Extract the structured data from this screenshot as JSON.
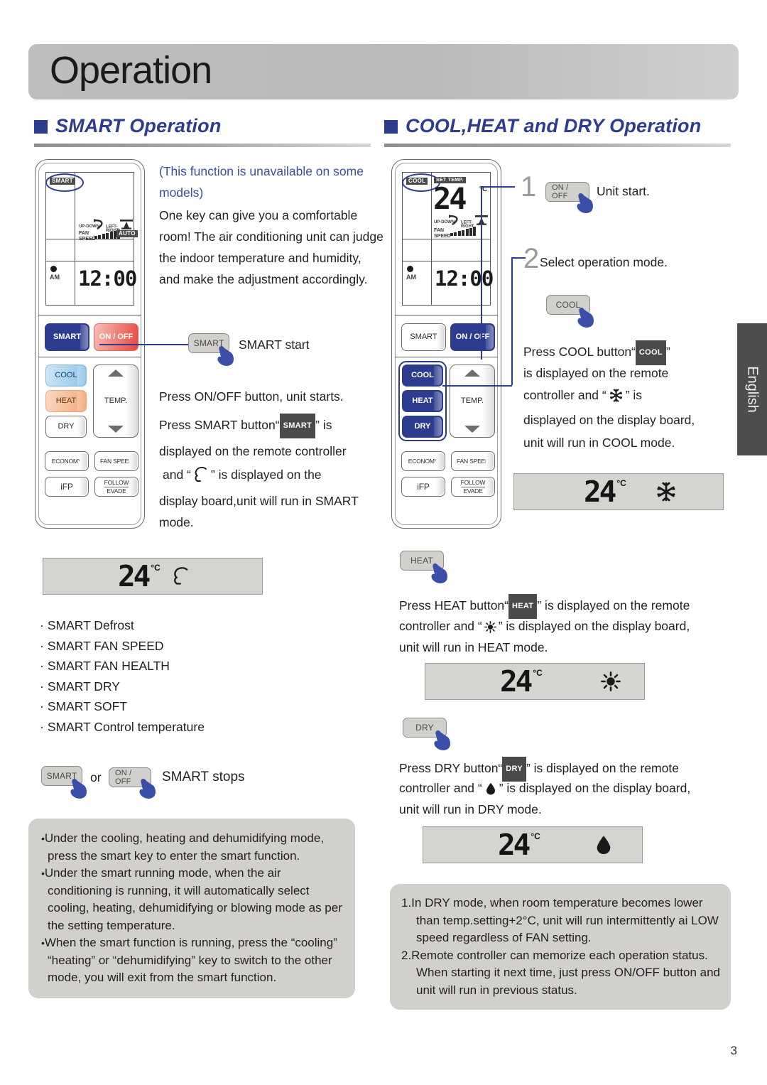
{
  "page": {
    "title": "Operation",
    "number": "3",
    "language_tab": "English"
  },
  "sections": {
    "left": {
      "heading": "SMART Operation",
      "note_blue": "(This function is unavailable on some models)",
      "intro": "One key can give you a comfortable room! The air conditioning unit can judge the indoor temperature and humidity, and make the adjustment accordingly.",
      "start_label": "SMART start",
      "start_key": "SMART",
      "instructions_line1": "Press ON/OFF button, unit starts.",
      "instructions_line2_a": "Press SMART button“",
      "instructions_badge": "SMART",
      "instructions_line2_b": "” is",
      "instructions_line3": "displayed on the remote controller",
      "instructions_line4_a": "and “",
      "instructions_line4_b": "” is displayed on the",
      "instructions_line5": "display board,unit will run in SMART",
      "instructions_line6": "mode.",
      "board": {
        "temp": "24",
        "unit": "°C",
        "icon": "smart-icon"
      },
      "features": [
        "SMART Defrost",
        "SMART FAN SPEED",
        "SMART FAN HEALTH",
        "SMART DRY",
        "SMART SOFT",
        "SMART Control temperature"
      ],
      "stop_key_a": "SMART",
      "stop_or": "or",
      "stop_key_b": "ON / OFF",
      "stop_label": "SMART stops",
      "notes": [
        "Under the cooling, heating and dehumidifying mode, press the smart key to enter the smart function.",
        "Under the smart running mode, when the air conditioning is running, it will automatically select cooling, heating, dehumidifying or blowing mode as per the setting temperature.",
        "When the smart function is running, press the “cooling” “heating” or “dehumidifying” key to switch to the other mode, you will exit from the smart function."
      ]
    },
    "right": {
      "heading": "COOL,HEAT and DRY Operation",
      "step1_num": "1",
      "step1_key": "ON / OFF",
      "step1_label": "Unit start.",
      "step2_num": "2",
      "step2_label": "Select operation mode.",
      "cool_key": "COOL",
      "cool_text_1a": "Press COOL button“",
      "cool_badge": "COOL",
      "cool_text_1b": "”",
      "cool_text_2": "is displayed on the remote",
      "cool_text_3a": "controller and “",
      "cool_text_3b": "” is",
      "cool_text_4": "displayed on the display board,",
      "cool_text_5": "unit will run in COOL mode.",
      "cool_board": {
        "temp": "24",
        "unit": "°C",
        "icon": "snowflake-icon"
      },
      "heat_key": "HEAT",
      "heat_text_1a": "Press HEAT button“",
      "heat_badge": "HEAT",
      "heat_text_1b": "” is displayed on the remote",
      "heat_text_2a": "controller and “",
      "heat_text_2b": "” is displayed on the display board,",
      "heat_text_3": "unit will run in HEAT mode.",
      "heat_board": {
        "temp": "24",
        "unit": "°C",
        "icon": "sun-icon"
      },
      "dry_key": "DRY",
      "dry_text_1a": "Press DRY button“",
      "dry_badge": "DRY",
      "dry_text_1b": "” is displayed on the remote",
      "dry_text_2a": "controller and “",
      "dry_text_2b": "” is displayed on the display board,",
      "dry_text_3": "unit will run in DRY mode.",
      "dry_board": {
        "temp": "24",
        "unit": "°C",
        "icon": "droplet-icon"
      },
      "notes": [
        "1.In DRY mode, when room temperature becomes lower than temp.setting+2°C, unit will run intermittently ai LOW speed regardless of FAN setting.",
        "2.Remote controller can memorize each operation status. When starting it next time, just press ON/OFF button and unit will run in previous status."
      ]
    }
  },
  "remote_left": {
    "lcd": {
      "mode_badge": "SMART",
      "updown_label": "UP-DOWN",
      "leftright_label": "LEFT-RIGHT",
      "fanspeed_label": "FAN SPEED",
      "auto_badge": "AUTO",
      "am_label": "AM",
      "clock": "12:00"
    },
    "buttons": {
      "smart": "SMART",
      "onoff": "ON / OFF",
      "cool": "COOL",
      "heat": "HEAT",
      "dry": "DRY",
      "temp": "TEMP.",
      "economy": "ECONOMY",
      "fanspeed": "FAN SPEED",
      "ifp": "iFP",
      "follow": "FOLLOW",
      "evade": "EVADE"
    }
  },
  "remote_right": {
    "lcd": {
      "mode_badge": "COOL",
      "settemp_badge": "SET TEMP.",
      "temp": "24",
      "unit": "°C",
      "updown_label": "UP-DOWN",
      "leftright_label": "LEFT-RIGHT",
      "fanspeed_label": "FAN SPEED",
      "am_label": "AM",
      "clock": "12:00"
    },
    "buttons": {
      "smart": "SMART",
      "onoff": "ON / OFF",
      "cool": "COOL",
      "heat": "HEAT",
      "dry": "DRY",
      "temp": "TEMP.",
      "economy": "ECONOMY",
      "fanspeed": "FAN SPEED",
      "ifp": "iFP",
      "follow": "FOLLOW",
      "evade": "EVADE"
    }
  },
  "colors": {
    "accent_blue": "#2e3c8f",
    "banner_grey": "#bdbdbd",
    "note_grey": "#d2d0cd",
    "heading_blue": "#2e3c8f"
  }
}
